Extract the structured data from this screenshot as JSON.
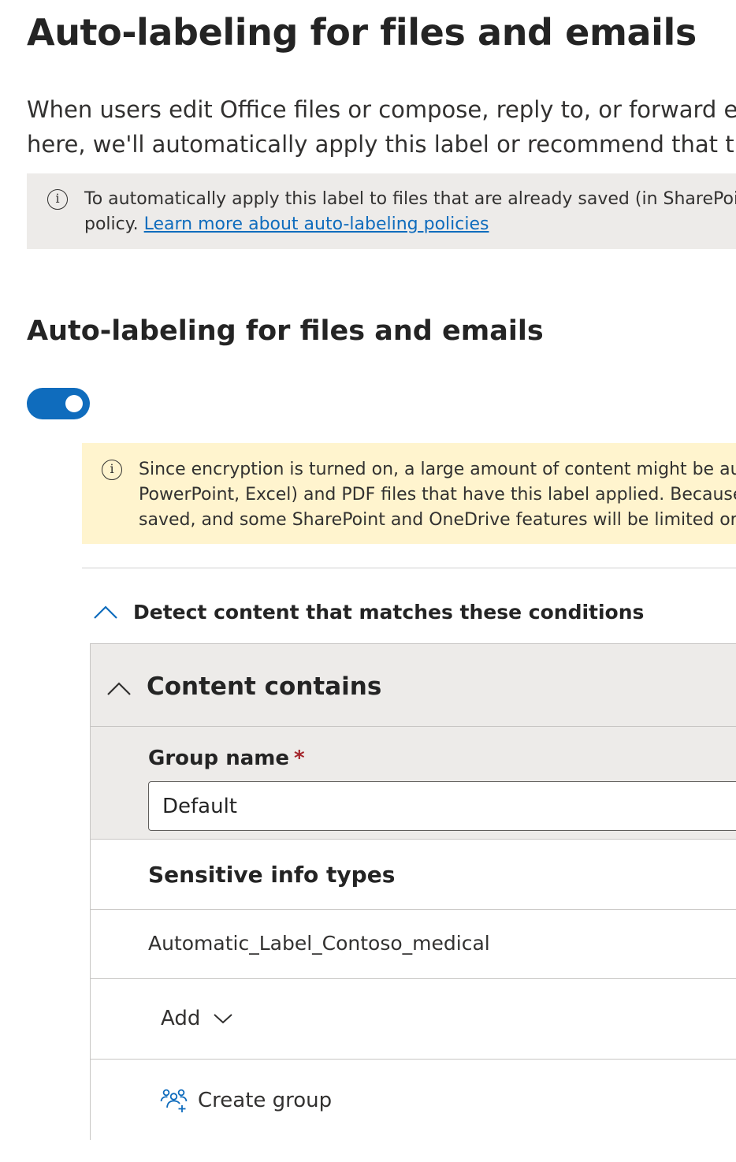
{
  "page": {
    "title": "Auto-labeling for files and emails",
    "description_lines": [
      "When users edit Office files or compose, reply to, or forward em",
      "here, we'll automatically apply this label or recommend that they"
    ]
  },
  "info_bar": {
    "icon": "info-icon",
    "line1": "To automatically apply this label to files that are already saved (in SharePoint a",
    "line2_prefix": "policy. ",
    "link_text": "Learn more about auto-labeling policies"
  },
  "section": {
    "title": "Auto-labeling for files and emails",
    "toggle": {
      "state": "on",
      "accent": "#0f6cbd"
    }
  },
  "warning_bar": {
    "icon": "info-icon",
    "background": "#fff4ce",
    "lines": [
      "Since encryption is turned on, a large amount of content might be autor",
      "PowerPoint, Excel) and PDF files that have this label applied. Because the",
      "saved, and some SharePoint and OneDrive features will be limited or un"
    ]
  },
  "conditions": {
    "header": "Detect content that matches these conditions",
    "content_contains": {
      "title": "Content contains",
      "group_name_label": "Group name",
      "required_marker": "*",
      "group_name_value": "Default",
      "sensitive_info_types_label": "Sensitive info types",
      "items": [
        "Automatic_Label_Contoso_medical"
      ],
      "add_label": "Add",
      "create_group_label": "Create group"
    }
  }
}
